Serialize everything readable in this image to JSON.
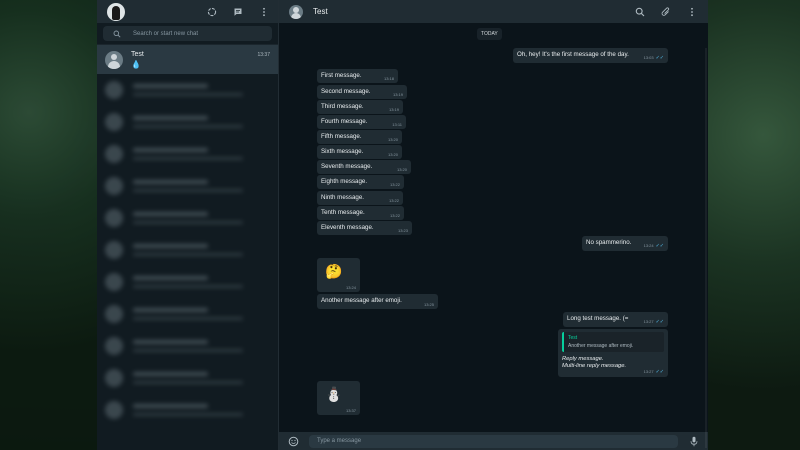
{
  "sidebar": {
    "search_placeholder": "Search or start new chat",
    "active_chat": {
      "name": "Test",
      "preview": "💧",
      "time": "13:37"
    },
    "blurred_rows": 11
  },
  "conversation": {
    "title": "Test",
    "day_label": "TODAY",
    "composer_placeholder": "Type a message"
  },
  "messages": {
    "m0": {
      "text": "Oh, hey! It's the first message of the day.",
      "time": "13:03"
    },
    "m1": {
      "text": "First message.",
      "time": "13:18"
    },
    "m2": {
      "text": "Second message.",
      "time": "13:19"
    },
    "m3": {
      "text": "Third message.",
      "time": "13:19"
    },
    "m4": {
      "text": "Fourth message.",
      "time": "13:11"
    },
    "m5": {
      "text": "Fifth message.",
      "time": "13:20"
    },
    "m6": {
      "text": "Sixth message.",
      "time": "13:20"
    },
    "m7": {
      "text": "Seventh message.",
      "time": "13:20"
    },
    "m8": {
      "text": "Eighth message.",
      "time": "13:22"
    },
    "m9": {
      "text": "Ninth message.",
      "time": "13:22"
    },
    "m10": {
      "text": "Tenth message.",
      "time": "13:22"
    },
    "m11": {
      "text": "Eleventh message.",
      "time": "13:23"
    },
    "m12": {
      "text": "No spammerino.",
      "time": "13:24"
    },
    "m13": {
      "emoji": "🤔",
      "time": "13:24"
    },
    "m14": {
      "text": "Another message after emoji.",
      "time": "13:25"
    },
    "m15": {
      "text": "Long test message. (=",
      "time": "13:27"
    },
    "m16": {
      "quote_name": "Test",
      "quote_text": "Another message after emoji.",
      "line1": "Reply message.",
      "line2": "Multi-line reply message.",
      "time": "13:27"
    },
    "m17": {
      "emoji": "⛄",
      "time": "13:37"
    }
  },
  "colors": {
    "accent_green": "#06cf9c",
    "read_tick_blue": "#53bdeb",
    "bubble_dark": "#202c33"
  }
}
